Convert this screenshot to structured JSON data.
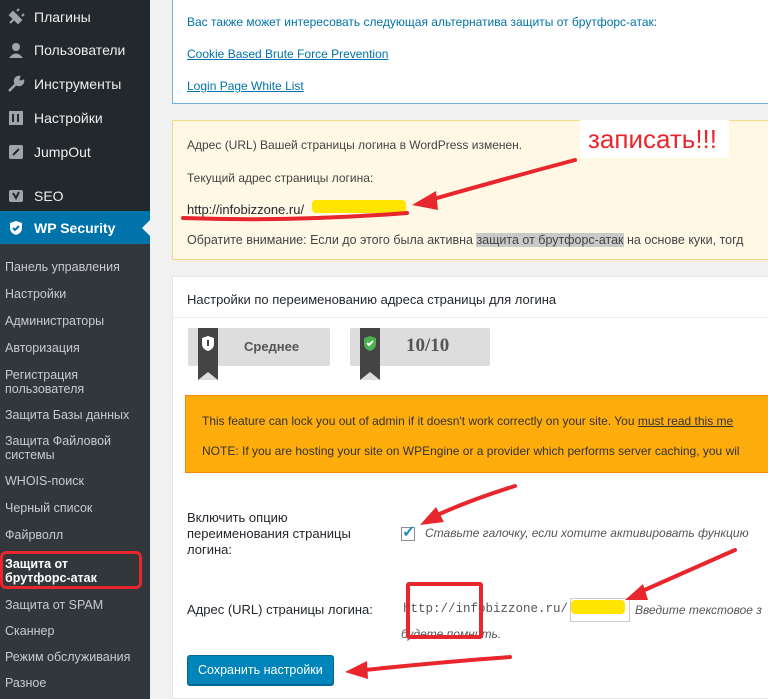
{
  "sidebar": {
    "items": [
      {
        "label": "Плагины",
        "icon": "plug-icon"
      },
      {
        "label": "Пользователи",
        "icon": "user-icon"
      },
      {
        "label": "Инструменты",
        "icon": "wrench-icon"
      },
      {
        "label": "Настройки",
        "icon": "settings-icon"
      },
      {
        "label": "JumpOut",
        "icon": "jumpout-icon"
      },
      {
        "label": "SEO",
        "icon": "yoast-icon"
      },
      {
        "label": "WP Security",
        "icon": "shield-icon"
      }
    ],
    "submenu": [
      "Панель управления",
      "Настройки",
      "Администраторы",
      "Авторизация",
      "Регистрация пользователя",
      "Защита Базы данных",
      "Защита Файловой системы",
      "WHOIS-поиск",
      "Черный список",
      "Файрволл",
      "Защита от брутфорс-атак",
      "Защита от SPAM",
      "Сканнер",
      "Режим обслуживания",
      "Разное"
    ]
  },
  "alternatives": {
    "intro": "Вас также может интересовать следующая альтернатива защиты от брутфорс-атак:",
    "link1": "Cookie Based Brute Force Prevention",
    "link2": "Login Page White List"
  },
  "notice": {
    "line1": "Адрес (URL) Вашей страницы логина в WordPress изменен.",
    "line2": "Текущий адрес страницы логина:",
    "url": "http://infobizzone.ru/",
    "line3_before": "Обратите внимание: Если до этого была активна ",
    "line3_highlight": "защита от брутфорс-атак",
    "line3_after": " на основе куки, тогд"
  },
  "settings": {
    "title": "Настройки по переименованию адреса страницы для логина",
    "badge1": "Среднее",
    "badge2": "10/10",
    "warning1_text": "This feature can lock you out of admin if it doesn't work correctly on your site. You ",
    "warning1_link": "must read this me",
    "warning2": "NOTE: If you are hosting your site on WPEngine or a provider which performs server caching, you wil",
    "enable_label_l1": "Включить опцию",
    "enable_label_l2": "переименования страницы",
    "enable_label_l3": "логина:",
    "enable_desc": "Ставьте галочку, если хотите активировать функцию",
    "url_label": "Адрес (URL) страницы логина:",
    "url_prefix": "http://infobizzone.ru/",
    "url_desc_l1": "Введите текстовое з",
    "url_desc_l2": "будете помнить.",
    "save_button": "Сохранить настройки"
  },
  "annotation": {
    "text": "записать!!!",
    "color": "#e8262d"
  }
}
